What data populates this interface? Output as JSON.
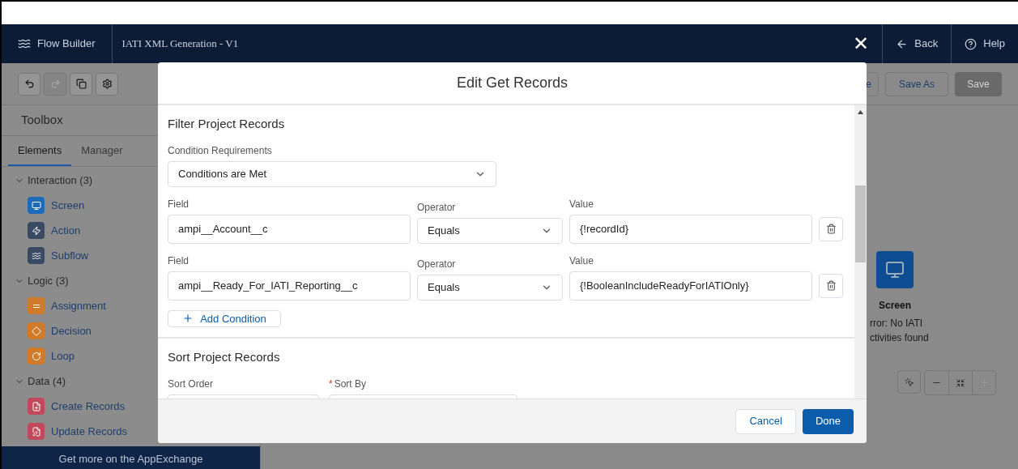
{
  "header": {
    "app_name": "Flow Builder",
    "flow_title": "IATI XML Generation - V1",
    "close": "✕",
    "back": "Back",
    "help": "Help"
  },
  "toolbar": {
    "buttons": [
      {
        "kind": "undo",
        "disabled": false
      },
      {
        "kind": "redo",
        "disabled": true
      },
      {
        "kind": "copy",
        "disabled": false
      },
      {
        "kind": "settings",
        "disabled": false
      }
    ],
    "cut_button": "e",
    "save_as": "Save As",
    "save": {
      "label": "Save",
      "disabled": true
    }
  },
  "toolbox": {
    "title": "Toolbox",
    "tabs": [
      {
        "label": "Elements",
        "selected": true
      },
      {
        "label": "Manager",
        "selected": false
      }
    ],
    "sections": [
      {
        "label": "Interaction (3)",
        "expanded": true,
        "items": [
          {
            "label": "Screen",
            "kind": "screen",
            "color": "#1d6ab8"
          },
          {
            "label": "Action",
            "kind": "action",
            "color": "#3a4a63"
          },
          {
            "label": "Subflow",
            "kind": "subflow",
            "color": "#3a4a63"
          }
        ]
      },
      {
        "label": "Logic (3)",
        "expanded": true,
        "items": [
          {
            "label": "Assignment",
            "kind": "assignment",
            "color": "#d07b2a"
          },
          {
            "label": "Decision",
            "kind": "decision",
            "color": "#d07b2a"
          },
          {
            "label": "Loop",
            "kind": "loop",
            "color": "#d07b2a"
          }
        ]
      },
      {
        "label": "Data (4)",
        "expanded": true,
        "items": [
          {
            "label": "Create Records",
            "kind": "create",
            "color": "#c2495b"
          },
          {
            "label": "Update Records",
            "kind": "update",
            "color": "#c2495b"
          }
        ]
      }
    ],
    "footer": "Get more on the AppExchange"
  },
  "canvas": {
    "node": {
      "label": "Screen",
      "note_lines": [
        "rror: No IATI",
        "ctivities found"
      ]
    }
  },
  "modal": {
    "title": "Edit Get Records",
    "filter": {
      "heading": "Filter Project Records",
      "requirement_label": "Condition Requirements",
      "requirement_value": "Conditions are Met",
      "conditions": [
        {
          "field_label": "Field",
          "field": "ampi__Account__c",
          "operator_label": "Operator",
          "operator": "Equals",
          "value_label": "Value",
          "value": "{!recordId}"
        },
        {
          "field_label": "Field",
          "field": "ampi__Ready_For_IATI_Reporting__c",
          "operator_label": "Operator",
          "operator": "Equals",
          "value_label": "Value",
          "value": "{!BooleanIncludeReadyForIATIOnly}"
        }
      ],
      "add_condition": "Add Condition"
    },
    "sort": {
      "heading": "Sort Project Records",
      "order_label": "Sort Order",
      "by_label": "Sort By",
      "by_required_mark": "*"
    },
    "cancel": "Cancel",
    "done": "Done"
  }
}
